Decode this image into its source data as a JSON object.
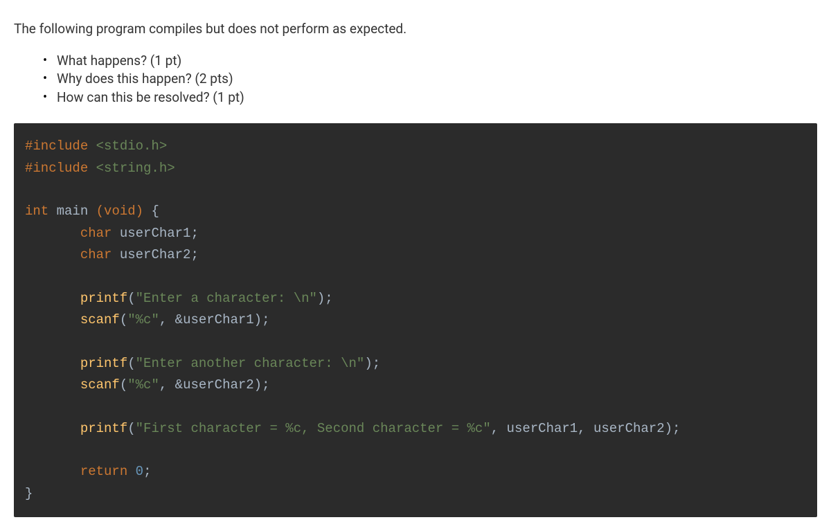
{
  "intro": "The following program compiles but does not perform as expected.",
  "questions": [
    "What happens? (1 pt)",
    "Why does this happen? (2 pts)",
    "How can this be resolved? (1 pt)"
  ],
  "code": {
    "line1_preproc": "#include",
    "line1_header": " <stdio.h>",
    "line2_preproc": "#include",
    "line2_header": " <string.h>",
    "line4_type1": "int",
    "line4_name": " main ",
    "line4_type2": "(void)",
    "line4_brace": " {",
    "line5_type": "char",
    "line5_rest": " userChar1;",
    "line6_type": "char",
    "line6_rest": " userChar2;",
    "line8_func": "printf",
    "line8_open": "(",
    "line8_str": "\"Enter a character: \\n\"",
    "line8_close": ");",
    "line9_func": "scanf",
    "line9_open": "(",
    "line9_str": "\"%c\"",
    "line9_mid": ", &userChar1);",
    "line11_func": "printf",
    "line11_open": "(",
    "line11_str": "\"Enter another character: \\n\"",
    "line11_close": ");",
    "line12_func": "scanf",
    "line12_open": "(",
    "line12_str": "\"%c\"",
    "line12_mid": ", &userChar2);",
    "line14_func": "printf",
    "line14_open": "(",
    "line14_str": "\"First character = %c, Second character = %c\"",
    "line14_close": ", userChar1, userChar2);",
    "line16_kw": "return",
    "line16_sp": " ",
    "line16_num": "0",
    "line16_semi": ";",
    "line17_brace": "}"
  }
}
